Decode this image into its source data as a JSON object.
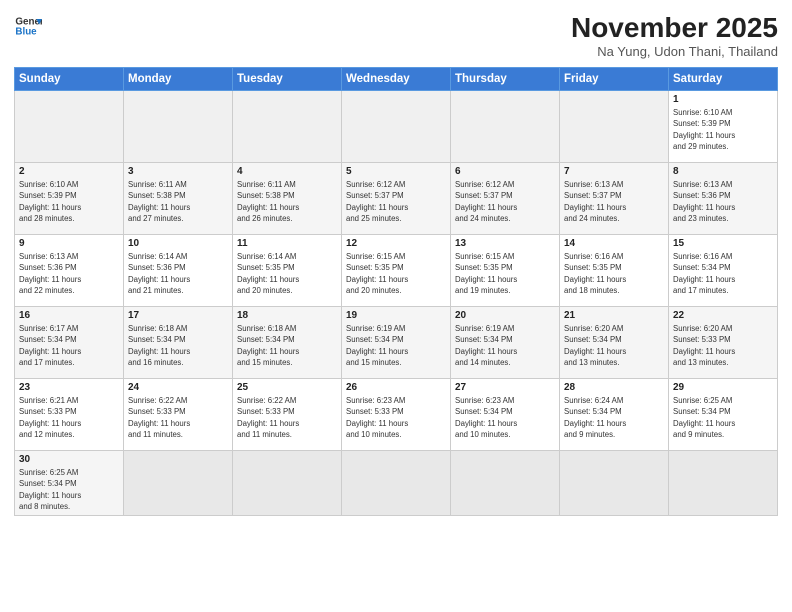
{
  "logo": {
    "line1": "General",
    "line2": "Blue"
  },
  "header": {
    "title": "November 2025",
    "location": "Na Yung, Udon Thani, Thailand"
  },
  "weekdays": [
    "Sunday",
    "Monday",
    "Tuesday",
    "Wednesday",
    "Thursday",
    "Friday",
    "Saturday"
  ],
  "weeks": [
    [
      {
        "day": "",
        "info": ""
      },
      {
        "day": "",
        "info": ""
      },
      {
        "day": "",
        "info": ""
      },
      {
        "day": "",
        "info": ""
      },
      {
        "day": "",
        "info": ""
      },
      {
        "day": "",
        "info": ""
      },
      {
        "day": "1",
        "info": "Sunrise: 6:10 AM\nSunset: 5:39 PM\nDaylight: 11 hours\nand 29 minutes."
      }
    ],
    [
      {
        "day": "2",
        "info": "Sunrise: 6:10 AM\nSunset: 5:39 PM\nDaylight: 11 hours\nand 28 minutes."
      },
      {
        "day": "3",
        "info": "Sunrise: 6:11 AM\nSunset: 5:38 PM\nDaylight: 11 hours\nand 27 minutes."
      },
      {
        "day": "4",
        "info": "Sunrise: 6:11 AM\nSunset: 5:38 PM\nDaylight: 11 hours\nand 26 minutes."
      },
      {
        "day": "5",
        "info": "Sunrise: 6:12 AM\nSunset: 5:37 PM\nDaylight: 11 hours\nand 25 minutes."
      },
      {
        "day": "6",
        "info": "Sunrise: 6:12 AM\nSunset: 5:37 PM\nDaylight: 11 hours\nand 24 minutes."
      },
      {
        "day": "7",
        "info": "Sunrise: 6:13 AM\nSunset: 5:37 PM\nDaylight: 11 hours\nand 24 minutes."
      },
      {
        "day": "8",
        "info": "Sunrise: 6:13 AM\nSunset: 5:36 PM\nDaylight: 11 hours\nand 23 minutes."
      }
    ],
    [
      {
        "day": "9",
        "info": "Sunrise: 6:13 AM\nSunset: 5:36 PM\nDaylight: 11 hours\nand 22 minutes."
      },
      {
        "day": "10",
        "info": "Sunrise: 6:14 AM\nSunset: 5:36 PM\nDaylight: 11 hours\nand 21 minutes."
      },
      {
        "day": "11",
        "info": "Sunrise: 6:14 AM\nSunset: 5:35 PM\nDaylight: 11 hours\nand 20 minutes."
      },
      {
        "day": "12",
        "info": "Sunrise: 6:15 AM\nSunset: 5:35 PM\nDaylight: 11 hours\nand 20 minutes."
      },
      {
        "day": "13",
        "info": "Sunrise: 6:15 AM\nSunset: 5:35 PM\nDaylight: 11 hours\nand 19 minutes."
      },
      {
        "day": "14",
        "info": "Sunrise: 6:16 AM\nSunset: 5:35 PM\nDaylight: 11 hours\nand 18 minutes."
      },
      {
        "day": "15",
        "info": "Sunrise: 6:16 AM\nSunset: 5:34 PM\nDaylight: 11 hours\nand 17 minutes."
      }
    ],
    [
      {
        "day": "16",
        "info": "Sunrise: 6:17 AM\nSunset: 5:34 PM\nDaylight: 11 hours\nand 17 minutes."
      },
      {
        "day": "17",
        "info": "Sunrise: 6:18 AM\nSunset: 5:34 PM\nDaylight: 11 hours\nand 16 minutes."
      },
      {
        "day": "18",
        "info": "Sunrise: 6:18 AM\nSunset: 5:34 PM\nDaylight: 11 hours\nand 15 minutes."
      },
      {
        "day": "19",
        "info": "Sunrise: 6:19 AM\nSunset: 5:34 PM\nDaylight: 11 hours\nand 15 minutes."
      },
      {
        "day": "20",
        "info": "Sunrise: 6:19 AM\nSunset: 5:34 PM\nDaylight: 11 hours\nand 14 minutes."
      },
      {
        "day": "21",
        "info": "Sunrise: 6:20 AM\nSunset: 5:34 PM\nDaylight: 11 hours\nand 13 minutes."
      },
      {
        "day": "22",
        "info": "Sunrise: 6:20 AM\nSunset: 5:33 PM\nDaylight: 11 hours\nand 13 minutes."
      }
    ],
    [
      {
        "day": "23",
        "info": "Sunrise: 6:21 AM\nSunset: 5:33 PM\nDaylight: 11 hours\nand 12 minutes."
      },
      {
        "day": "24",
        "info": "Sunrise: 6:22 AM\nSunset: 5:33 PM\nDaylight: 11 hours\nand 11 minutes."
      },
      {
        "day": "25",
        "info": "Sunrise: 6:22 AM\nSunset: 5:33 PM\nDaylight: 11 hours\nand 11 minutes."
      },
      {
        "day": "26",
        "info": "Sunrise: 6:23 AM\nSunset: 5:33 PM\nDaylight: 11 hours\nand 10 minutes."
      },
      {
        "day": "27",
        "info": "Sunrise: 6:23 AM\nSunset: 5:34 PM\nDaylight: 11 hours\nand 10 minutes."
      },
      {
        "day": "28",
        "info": "Sunrise: 6:24 AM\nSunset: 5:34 PM\nDaylight: 11 hours\nand 9 minutes."
      },
      {
        "day": "29",
        "info": "Sunrise: 6:25 AM\nSunset: 5:34 PM\nDaylight: 11 hours\nand 9 minutes."
      }
    ],
    [
      {
        "day": "30",
        "info": "Sunrise: 6:25 AM\nSunset: 5:34 PM\nDaylight: 11 hours\nand 8 minutes."
      },
      {
        "day": "",
        "info": ""
      },
      {
        "day": "",
        "info": ""
      },
      {
        "day": "",
        "info": ""
      },
      {
        "day": "",
        "info": ""
      },
      {
        "day": "",
        "info": ""
      },
      {
        "day": "",
        "info": ""
      }
    ]
  ]
}
